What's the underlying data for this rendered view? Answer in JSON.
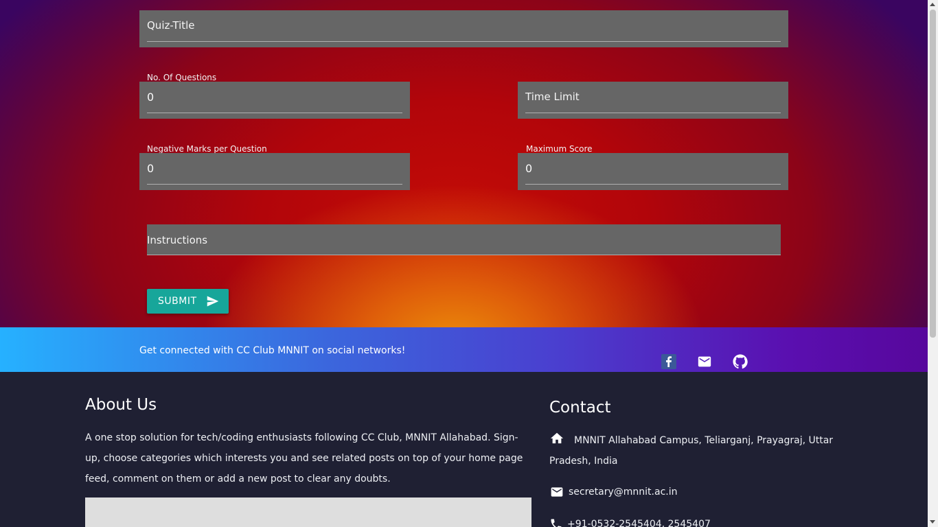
{
  "form": {
    "quiz_title": {
      "placeholder": "Quiz-Title",
      "value": ""
    },
    "num_questions": {
      "label": "No. Of Questions",
      "value": "0"
    },
    "time_limit": {
      "placeholder": "Time Limit",
      "value": ""
    },
    "negative_marks": {
      "label": "Negative Marks per Question",
      "value": "0"
    },
    "maximum_score": {
      "label": "Maximum Score",
      "value": "0"
    },
    "instructions": {
      "placeholder": "Instructions",
      "value": ""
    },
    "submit_label": "SUBMIT"
  },
  "social": {
    "text": "Get connected with CC Club MNNIT on social networks!",
    "icons": [
      "facebook-icon",
      "mail-icon",
      "github-icon"
    ]
  },
  "footer": {
    "about": {
      "title": "About Us",
      "text": "A one stop solution for tech/coding enthusiasts following CC Club, MNNIT Allahabad. Sign-up, choose categories which interests you and see related posts on top of your home page feed, comment on them or add a new post to clear any doubts."
    },
    "contact": {
      "title": "Contact",
      "address": "MNNIT Allahabad Campus, Teliarganj, Prayagraj, Uttar Pradesh, India",
      "email": "secretary@mnnit.ac.in",
      "phone": "+91-0532-2545404, 2545407"
    }
  },
  "colors": {
    "field_bg": "#666666",
    "submit_bg": "#17a69a",
    "footer_bg": "#1f2033",
    "social_gradient_start": "#26b1ff",
    "social_gradient_end": "#57079c"
  }
}
